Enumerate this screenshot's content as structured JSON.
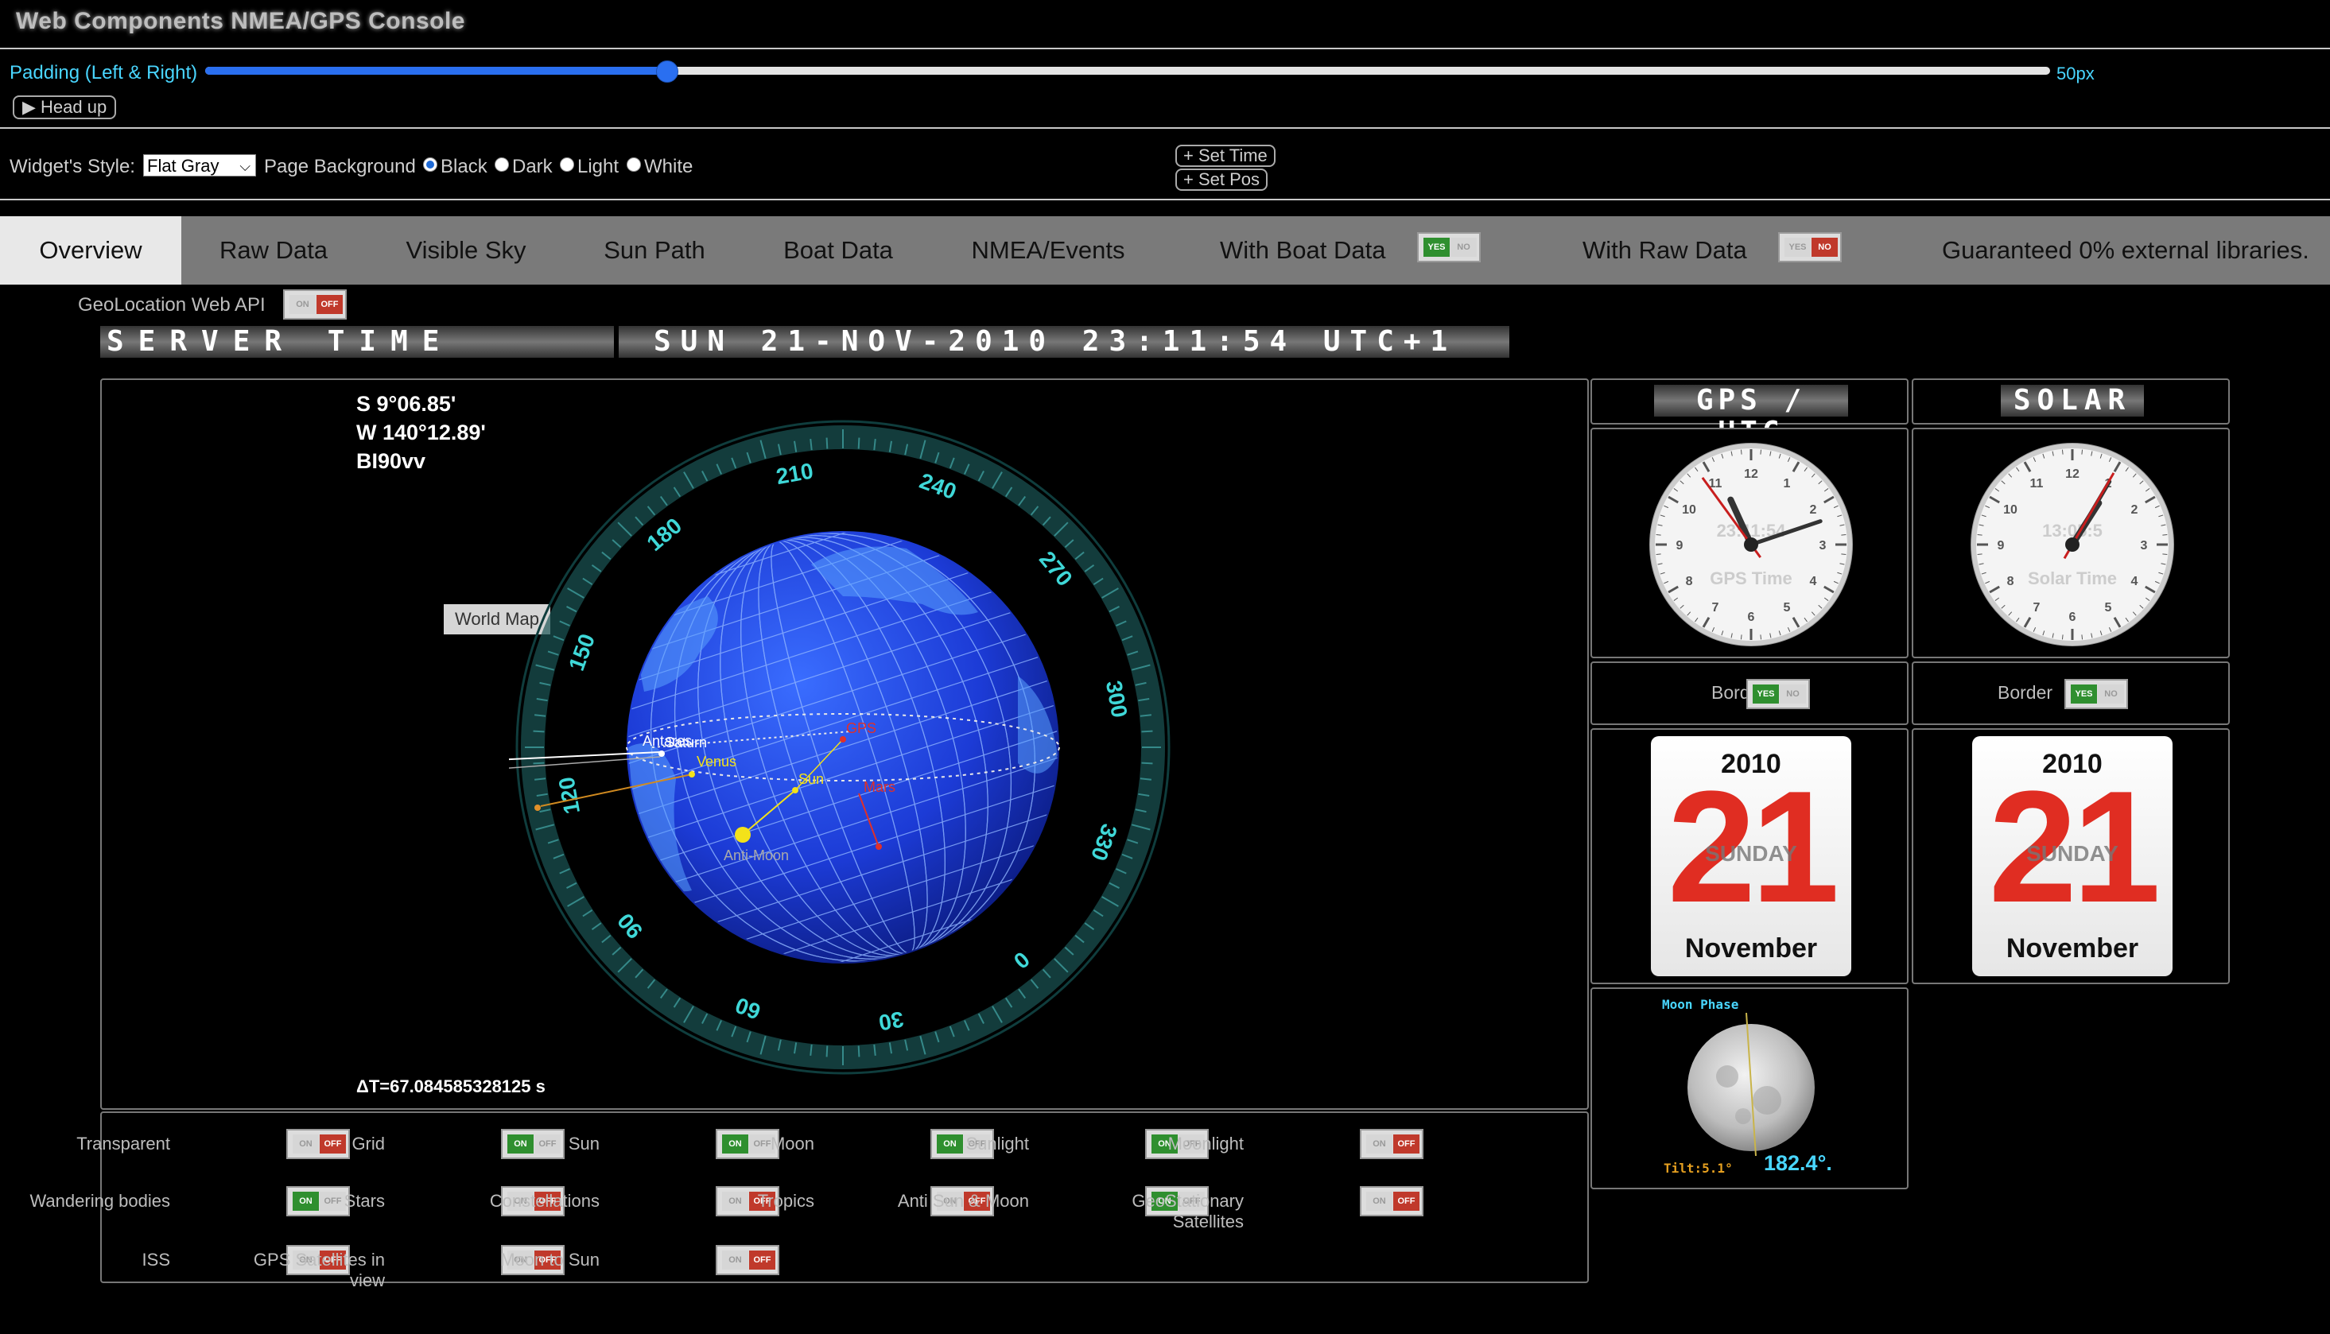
{
  "app": {
    "title": "Web Components NMEA/GPS Console"
  },
  "padding": {
    "label": "Padding (Left & Right)",
    "value": "50px",
    "fraction": 0.25
  },
  "head_up": {
    "label": "▶ Head up"
  },
  "widget_style": {
    "label": "Widget's Style:",
    "selected": "Flat Gray"
  },
  "page_background": {
    "label": "Page Background",
    "options": [
      "Black",
      "Dark",
      "Light",
      "White"
    ],
    "selected": "Black"
  },
  "set_buttons": {
    "set_time": "+ Set Time",
    "set_pos": "+ Set Pos"
  },
  "tabs": [
    {
      "label": "Overview",
      "active": true
    },
    {
      "label": "Raw Data"
    },
    {
      "label": "Visible Sky"
    },
    {
      "label": "Sun Path"
    },
    {
      "label": "Boat Data"
    },
    {
      "label": "NMEA/Events"
    }
  ],
  "tab_toggles": {
    "with_boat_data": {
      "label": "With Boat Data",
      "state": "yes"
    },
    "with_raw_data": {
      "label": "With Raw Data",
      "state": "no"
    },
    "note": "Guaranteed 0% external libraries."
  },
  "geolocation": {
    "label": "GeoLocation Web API",
    "state": "off"
  },
  "server_time": {
    "label": "SERVER TIME",
    "value": "SUN 21-NOV-2010 23:11:54 UTC+1"
  },
  "globe": {
    "lat": "S 9°06.85'",
    "lng": "W 140°12.89'",
    "grid": "BI90vv",
    "world_map_button": "World Map",
    "delta_t": "ΔT=67.084585328125 s",
    "dial_labels": [
      "210",
      "240",
      "270",
      "300",
      "330",
      "0",
      "30",
      "60",
      "90",
      "120",
      "150",
      "180"
    ],
    "body_labels": {
      "antares": "Antares",
      "saturn": "Saturn",
      "venus": "Venus",
      "sun": "Sun",
      "gps": "GPS",
      "mars": "Mars",
      "anti_moon": "Anti-Moon"
    },
    "colors": {
      "ocean": "#1e3fd8",
      "grid": "#7fa8ff",
      "gps": "#e0302a",
      "sun": "#f3e21a"
    }
  },
  "options": [
    {
      "label": "Transparent",
      "state": "off"
    },
    {
      "label": "Grid",
      "state": "on"
    },
    {
      "label": "Sun",
      "state": "on"
    },
    {
      "label": "Moon",
      "state": "on"
    },
    {
      "label": "Sunlight",
      "state": "on"
    },
    {
      "label": "Moonlight",
      "state": "off"
    },
    {
      "label": "Wandering bodies",
      "state": "on"
    },
    {
      "label": "Stars",
      "state": "off"
    },
    {
      "label": "Constellations",
      "state": "off"
    },
    {
      "label": "Tropics",
      "state": "off"
    },
    {
      "label": "Anti Sun & Moon",
      "state": "on"
    },
    {
      "label": "GeoStationary Satellites",
      "state": "off"
    },
    {
      "label": "ISS",
      "state": "off"
    },
    {
      "label": "GPS Satellites in view",
      "state": "off"
    },
    {
      "label": "Moon to Sun",
      "state": "off"
    }
  ],
  "toggle_text": {
    "on": "ON",
    "off": "OFF",
    "yes": "YES",
    "no": "NO"
  },
  "gps_clock": {
    "header": "GPS / UTC",
    "caption": "GPS Time",
    "digital": "23:11:54",
    "hours": 23,
    "minutes": 11,
    "seconds": 54
  },
  "solar_clock": {
    "header": "SOLAR",
    "caption": "Solar Time",
    "digital": "13:05:5",
    "hours": 13,
    "minutes": 5,
    "seconds": 5
  },
  "border_toggle": {
    "label": "Border",
    "state": "yes"
  },
  "calendar": {
    "year": "2010",
    "day": "21",
    "weekday": "SUNDAY",
    "month": "November"
  },
  "moon_phase": {
    "title": "Moon Phase",
    "tilt": "Tilt:5.1°",
    "angle": "182.4°."
  }
}
